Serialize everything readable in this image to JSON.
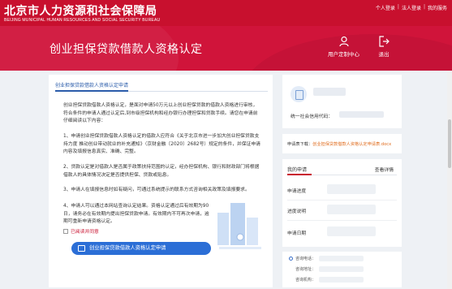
{
  "header": {
    "title_cn": "北京市人力资源和社会保障局",
    "title_en": "BEIJING MUNICIPAL HUMAN RESOURCES AND SOCIAL SECURITY BUREAU",
    "links": [
      "个人登录",
      "法人登录",
      "我的服务"
    ],
    "separator": "|"
  },
  "banner": {
    "title": "创业担保贷款借款人资格认定",
    "user_center_label": "用户定制中心",
    "logout_label": "退出"
  },
  "main": {
    "section_title": "创业担保贷款借款人资格认定申请",
    "paragraphs": [
      "创业担保贷款借款人资格认定，是面对申请50万元以上创业担保贷款的借款人资格进行审核，符合条件的申请人通过认定后,到市级担保机构和经办银行办理担保和贷款手续。请您在申请前仔细阅读以下内容：",
      "1、申请创业担保贷款借款人资格认定的借款人应符合《关于北京市进一步加大创业担保贷款支持力度 推动创业带动就业的补充通知》（京财金融〔2020〕2682号）规定的条件，并保证申请内容及填报信息真实、准确、完整。",
      "2、贷款认定是对借款人是否属于政策扶持范围的认定，经办担保机构、银行和财政部门将根据借款人的具体情况决定是否提供担保、贷款或贴息。",
      "3、申请人在填报信息时如有疑问，可通过系统提示的联系方式咨询相关政策及填报要求。",
      "4、申请人可以通过本网站查询认定结果。资格认定通过后有效期为90日，请务必在有效期内提出担保贷款申请。有效期内不可再次申请，逾期可重新申请资格认定。"
    ],
    "checkbox_label": "已阅读并同意",
    "apply_button": "创业担保贷款借款人资格认定申请"
  },
  "right": {
    "credit_code_label": "统一社会信用代码：",
    "download_prefix": "申请表下载：",
    "download_link": "创业担保贷款借款人资格认定申请表.docx",
    "my_apply": "我的申请",
    "view_detail": "查看详情",
    "rows": [
      "申请进度",
      "进度说明",
      "申请日期"
    ],
    "contact": [
      "咨询电话：",
      "咨询地址：",
      "咨询机构："
    ]
  },
  "colors": {
    "brand_red": "#c8102e",
    "accent_blue": "#2b6ed6",
    "link_orange": "#e06d1f"
  },
  "icons": [
    "user-center-icon",
    "logout-icon",
    "avatar-icon",
    "document-icon",
    "phone-icon"
  ]
}
